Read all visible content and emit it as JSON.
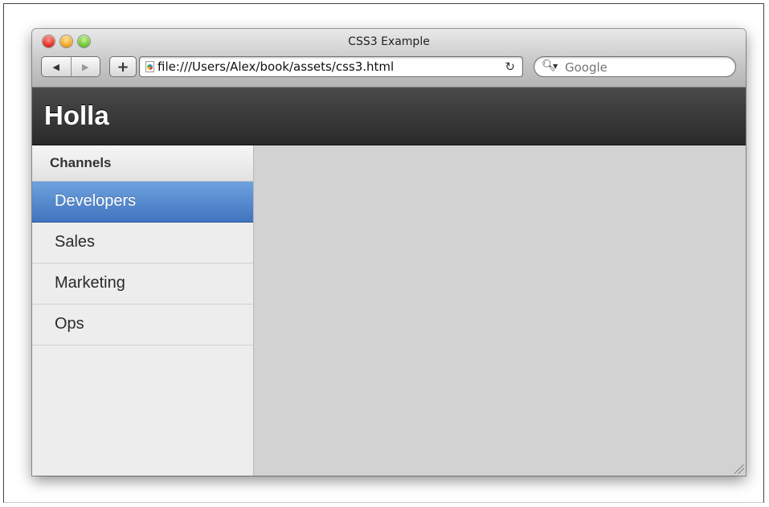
{
  "window": {
    "title": "CSS3 Example"
  },
  "toolbar": {
    "back_icon": "back-arrow-icon",
    "forward_icon": "forward-arrow-icon",
    "add_icon": "plus-icon",
    "url": "file:///Users/Alex/book/assets/css3.html",
    "reload_icon": "reload-icon",
    "search_placeholder": "Google"
  },
  "app": {
    "title": "Holla",
    "header_gradient": [
      "#4a4a4a",
      "#2a2a2a"
    ]
  },
  "sidebar": {
    "heading": "Channels",
    "items": [
      {
        "label": "Developers",
        "active": true
      },
      {
        "label": "Sales",
        "active": false
      },
      {
        "label": "Marketing",
        "active": false
      },
      {
        "label": "Ops",
        "active": false
      }
    ],
    "active_color": "#4f84cc"
  }
}
